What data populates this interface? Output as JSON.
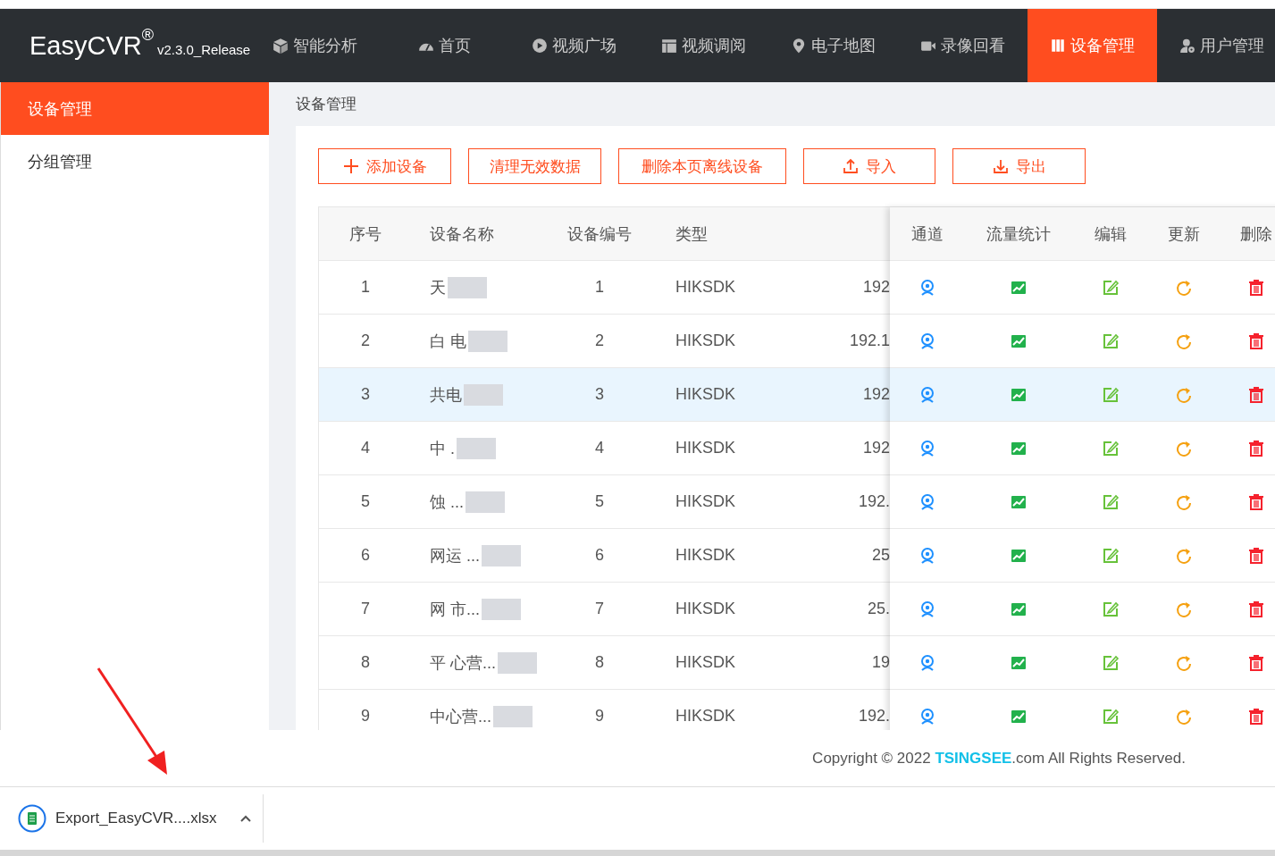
{
  "header": {
    "logo": "EasyCVR",
    "logo_mark": "®",
    "version": "v2.3.0_Release",
    "nav": [
      {
        "label": "智能分析",
        "selected": false
      },
      {
        "label": "首页",
        "selected": false
      },
      {
        "label": "视频广场",
        "selected": false
      },
      {
        "label": "视频调阅",
        "selected": false
      },
      {
        "label": "电子地图",
        "selected": false
      },
      {
        "label": "录像回看",
        "selected": false
      },
      {
        "label": "设备管理",
        "selected": true
      },
      {
        "label": "用户管理",
        "selected": false
      }
    ]
  },
  "sidebar": {
    "items": [
      {
        "label": "设备管理",
        "selected": true
      },
      {
        "label": "分组管理",
        "selected": false
      }
    ]
  },
  "breadcrumb": "设备管理",
  "toolbar": [
    {
      "label": "添加设备",
      "kind": "add"
    },
    {
      "label": "清理无效数据",
      "kind": "plain"
    },
    {
      "label": "删除本页离线设备",
      "kind": "plain"
    },
    {
      "label": "导入",
      "kind": "import"
    },
    {
      "label": "导出",
      "kind": "export"
    }
  ],
  "table": {
    "columns": [
      "序号",
      "设备名称",
      "设备编号",
      "类型"
    ],
    "fixed_columns": [
      "通道",
      "流量统计",
      "编辑",
      "更新",
      "删除"
    ],
    "rows": [
      {
        "index": "1",
        "name": "天",
        "number": "1",
        "type": "HIKSDK",
        "column_5": "192",
        "selected": false
      },
      {
        "index": "2",
        "name": "白 电",
        "number": "2",
        "type": "HIKSDK",
        "column_5": "192.1",
        "selected": false
      },
      {
        "index": "3",
        "name": "共电",
        "number": "3",
        "type": "HIKSDK",
        "column_5": "192",
        "selected": true
      },
      {
        "index": "4",
        "name": "中 .",
        "number": "4",
        "type": "HIKSDK",
        "column_5": "192",
        "selected": false
      },
      {
        "index": "5",
        "name": "蚀 ...",
        "number": "5",
        "type": "HIKSDK",
        "column_5": "192.",
        "selected": false
      },
      {
        "index": "6",
        "name": "网运 ...",
        "number": "6",
        "type": "HIKSDK",
        "column_5": "25",
        "selected": false
      },
      {
        "index": "7",
        "name": "网 市...",
        "number": "7",
        "type": "HIKSDK",
        "column_5": "25.",
        "selected": false
      },
      {
        "index": "8",
        "name": "平 心营...",
        "number": "8",
        "type": "HIKSDK",
        "column_5": "19",
        "selected": false
      },
      {
        "index": "9",
        "name": "中心营...",
        "number": "9",
        "type": "HIKSDK",
        "column_5": "192.",
        "selected": false
      }
    ]
  },
  "footer": {
    "prefix": "Copyright © 2022",
    "brand": "TSINGSEE",
    "suffix": ".com All Rights Reserved."
  },
  "download": {
    "file": "Export_EasyCVR....xlsx"
  }
}
